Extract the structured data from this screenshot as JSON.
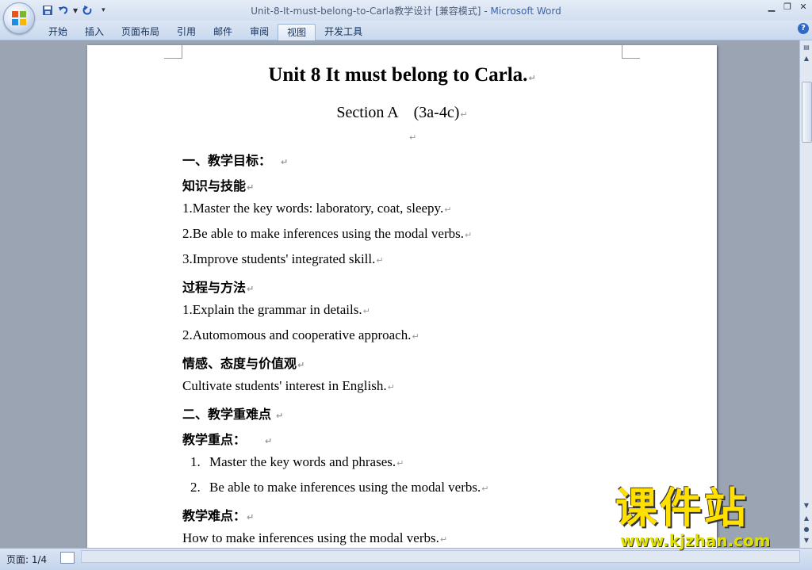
{
  "window": {
    "doc_name": "Unit-8-It-must-belong-to-Carla教学设计 [兼容模式]",
    "separator": " - ",
    "app_name": "Microsoft Word"
  },
  "ribbon": {
    "tabs": [
      "开始",
      "插入",
      "页面布局",
      "引用",
      "邮件",
      "审阅",
      "视图",
      "开发工具"
    ],
    "active_tab": "视图",
    "help": "?"
  },
  "document": {
    "title": "Unit 8 It must belong to Carla.",
    "subtitle": "Section A　(3a-4c)",
    "lines": [
      {
        "text": "一、教学目标：",
        "style": "bold"
      },
      {
        "text": "知识与技能",
        "style": "bold"
      },
      {
        "text": "1.Master the key words: laboratory, coat, sleepy.",
        "style": "normal"
      },
      {
        "text": "2.Be able to make inferences using the modal verbs.",
        "style": "normal"
      },
      {
        "text": "3.Improve students' integrated skill.",
        "style": "normal"
      },
      {
        "text": "过程与方法",
        "style": "bold"
      },
      {
        "text": "1.Explain the grammar in details.",
        "style": "normal"
      },
      {
        "text": "2.Automomous and cooperative approach.",
        "style": "normal"
      },
      {
        "text": "情感、态度与价值观",
        "style": "bold"
      },
      {
        "text": "Cultivate students' interest in English.",
        "style": "normal"
      },
      {
        "text": "二、教学重难点",
        "style": "bold"
      },
      {
        "text": "教学重点：",
        "style": "bold"
      },
      {
        "num": "1.",
        "text": "Master the key words and phrases.",
        "style": "list"
      },
      {
        "num": "2.",
        "text": "Be able to make inferences using the modal verbs.",
        "style": "list"
      },
      {
        "text": "教学难点：",
        "style": "bold"
      },
      {
        "text": "How to make inferences using the modal verbs.",
        "style": "normal"
      }
    ]
  },
  "status": {
    "page": "页面: 1/4"
  },
  "watermark": {
    "text": "课件站",
    "url": "www.kjzhan.com"
  }
}
